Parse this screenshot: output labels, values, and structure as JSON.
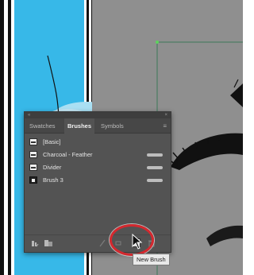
{
  "panel": {
    "tabs": [
      {
        "label": "Swatches",
        "active": false
      },
      {
        "label": "Brushes",
        "active": true
      },
      {
        "label": "Symbols",
        "active": false
      }
    ],
    "collapse_icon": "double-chevron-icon",
    "close_icon": "close-icon",
    "menu_icon": "panel-menu-icon",
    "brushes": [
      {
        "label": "[Basic]",
        "thumb": "basic"
      },
      {
        "label": "Charcoal - Feather",
        "thumb": "charcoal"
      },
      {
        "label": "Divider",
        "thumb": "divider"
      },
      {
        "label": "Brush 3",
        "thumb": "brush3"
      }
    ],
    "bottom_icons": [
      "brush-libraries-icon",
      "libraries-panel-icon",
      "remove-brush-stroke-icon",
      "brush-options-icon",
      "new-brush-icon",
      "delete-brush-icon"
    ]
  },
  "tooltip": {
    "label": "New Brush"
  },
  "colors": {
    "canvas": "#8d8d8d",
    "artboard_blue": "#37b8e8",
    "panel_bg": "#535353",
    "highlight": "#d4282e"
  }
}
